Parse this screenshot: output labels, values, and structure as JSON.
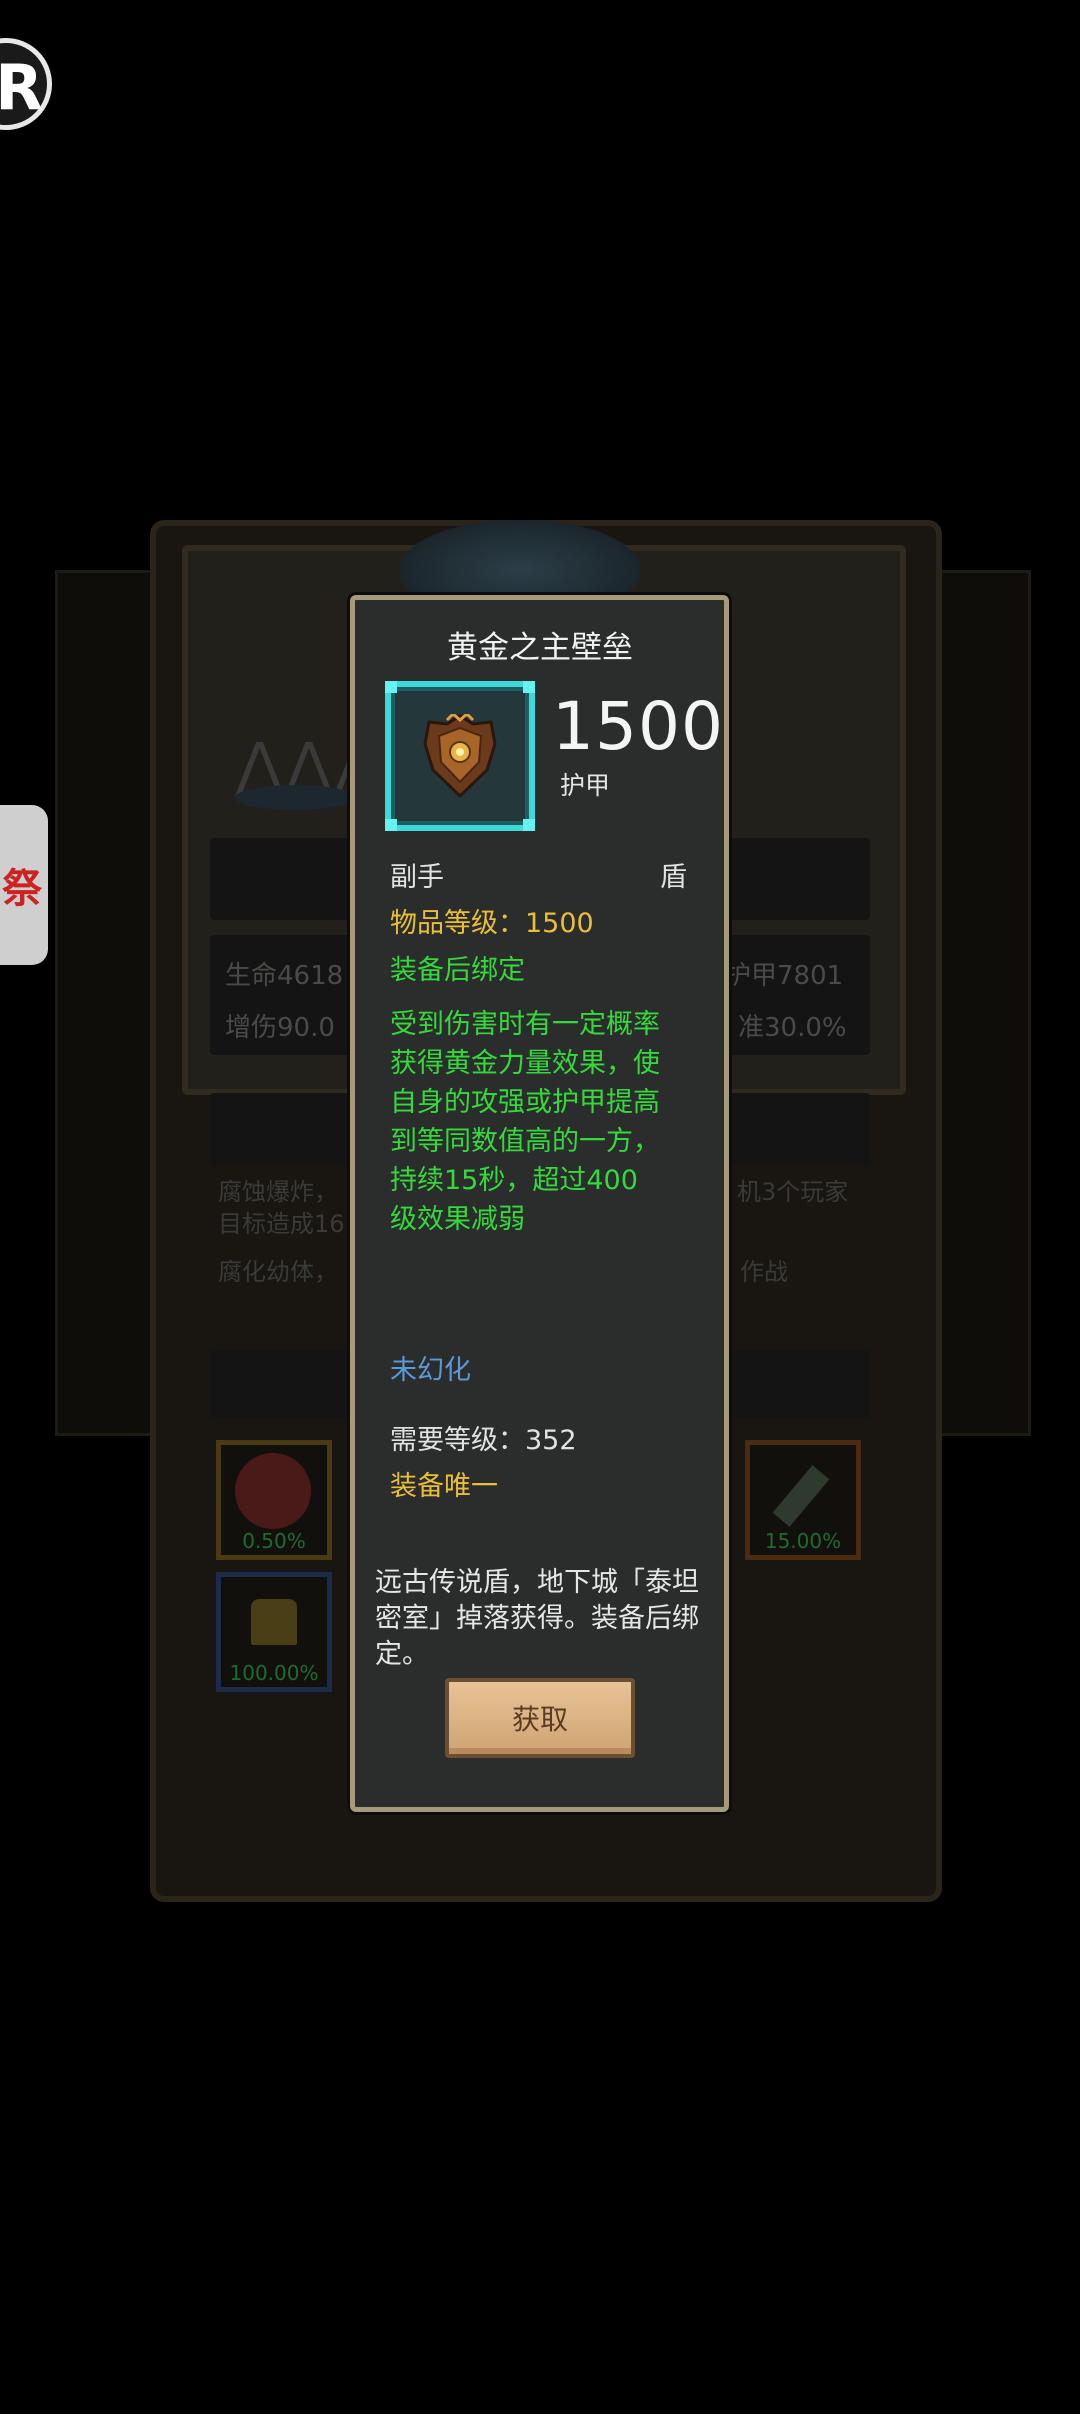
{
  "background": {
    "stats": {
      "hp_partial": "生命4618",
      "armor_partial": "护甲7801",
      "dmg_partial": "增伤90.0",
      "acc_partial": "准30.0%"
    },
    "skills": {
      "line1_left": "腐蚀爆炸，",
      "line1_right": "机3个玩家",
      "line2_left": "目标造成16",
      "line3_left": "腐化幼体，",
      "line3_right": "作战"
    },
    "drops": [
      {
        "pct": "0.50%"
      },
      {
        "pct": "15.00%"
      },
      {
        "pct": "100.00%"
      }
    ]
  },
  "overlay": {
    "recorder_glyph": "R",
    "side_tab_glyph": "祭"
  },
  "item": {
    "name": "黄金之主壁垒",
    "icon": "golden-shield-icon",
    "armor_value": "1500",
    "armor_label": "护甲",
    "slot": "副手",
    "type": "盾",
    "item_level": "物品等级：1500",
    "bind_rule": "装备后绑定",
    "effect": "受到伤害时有一定概率获得黄金力量效果，使自身的攻强或护甲提高到等同数值高的一方，持续15秒，超过400级效果减弱",
    "transmog": "未幻化",
    "required_level": "需要等级：352",
    "unique": "装备唯一",
    "lore": "远古传说盾，地下城「泰坦密室」掉落获得。装备后绑定。",
    "obtain_button": "获取"
  },
  "colors": {
    "frame_cyan": "#3fd8d8",
    "gold_text": "#e8be3a",
    "green_text": "#35d93c",
    "blue_text": "#5b98d6",
    "card_border": "#a59a7c"
  }
}
